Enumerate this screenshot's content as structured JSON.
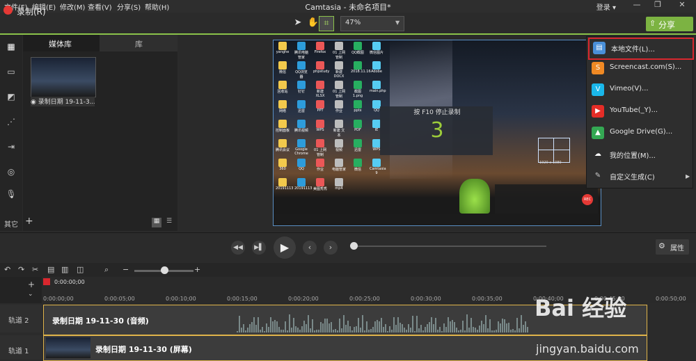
{
  "menubar": {
    "items": [
      "文件(F)",
      "编辑(E)",
      "修改(M)",
      "查看(V)",
      "分享(S)",
      "帮助(H)"
    ],
    "title": "Camtasia - 未命名项目*",
    "login": "登录 ▾"
  },
  "toolbar": {
    "record_label": "录制(R)",
    "zoom": "47%",
    "share_label": "分享"
  },
  "media": {
    "tab_media": "媒体库",
    "tab_library": "库",
    "clip_label": "◉ 录制日期 19-11-3...",
    "other_label": "其它"
  },
  "preview": {
    "countdown_label": "按 F10 停止录制",
    "countdown_value": "3",
    "rec_size": "1920 x 1080",
    "rec_mini_button": "REC",
    "desktop_icons": [
      "yanghe",
      "腾讯电脑管家",
      "Firefox",
      "01 上网管制",
      "QQ截图",
      "微信图片",
      "微信",
      "QQ浏览器",
      "phpstudy",
      "新建 DOCX",
      "2018.11.16",
      "Adobe",
      "回收站",
      "钉钉",
      "新建 XLSX",
      "01 上网管制",
      "截图 1.png",
      "main.php",
      "网络",
      "迅雷",
      "PPT",
      "作业",
      "pptx",
      "QQ",
      "控制面板",
      "腾讯视频",
      "WPS",
      "新建 文本",
      "PDF",
      "IE",
      "腾讯会议",
      "Google Chrome",
      "01 上网管制",
      "视频",
      "迅雷",
      "WPS",
      "360",
      "QQ",
      "作业",
      "电脑管家",
      "微信",
      "Camtasia 9",
      "20191113",
      "20191113",
      "美图秀秀",
      "mp4"
    ]
  },
  "share_menu": {
    "items": [
      {
        "label": "本地文件(L)...",
        "icon": "film-icon",
        "color": "#4a90d9"
      },
      {
        "label": "Screencast.com(S)...",
        "icon": "screencast-icon",
        "color": "#f08a24"
      },
      {
        "label": "Vimeo(V)...",
        "icon": "vimeo-icon",
        "color": "#1ab7ea"
      },
      {
        "label": "YouTube(_Y)...",
        "icon": "youtube-icon",
        "color": "#e52d27"
      },
      {
        "label": "Google Drive(G)...",
        "icon": "google-drive-icon",
        "color": "#34a853"
      },
      {
        "label": "我的位置(M)...",
        "icon": "cloud-icon",
        "color": "#ffffff"
      },
      {
        "label": "自定义生成(C)",
        "icon": "tools-icon",
        "color": "#cccccc"
      }
    ]
  },
  "playback": {
    "properties_label": "属性"
  },
  "timeline": {
    "playhead_time": "0:00:00;00",
    "ticks": [
      "0:00:00;00",
      "0:00:05;00",
      "0:00:10;00",
      "0:00:15;00",
      "0:00:20;00",
      "0:00:25;00",
      "0:00:30;00",
      "0:00:35;00",
      "0:00:40;00",
      "0:00:45;00",
      "0:00:50;00"
    ],
    "track2_label": "轨道 2",
    "track1_label": "轨道 1",
    "track2_clip": "录制日期 19-11-30 (音频)",
    "track1_clip": "录制日期 19-11-30 (屏幕)"
  },
  "watermark": {
    "text": "Bai 经验",
    "url": "jingyan.baidu.com"
  },
  "colors": {
    "accent": "#8bc34a",
    "share": "#7cb342",
    "record": "#e53935",
    "highlight": "#d9272e",
    "clip_border": "#e0b44a"
  }
}
